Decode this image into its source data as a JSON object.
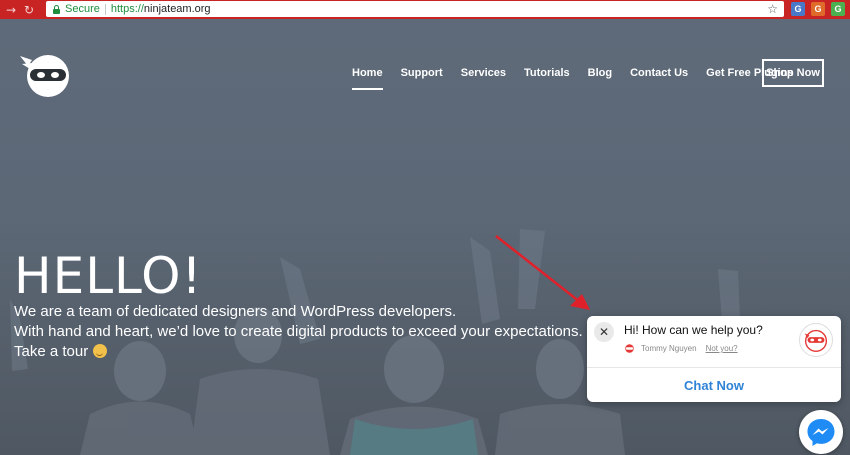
{
  "browser": {
    "back_icon": "back-arrow-icon",
    "reload_icon": "reload-icon",
    "secure_label": "Secure",
    "url_protocol": "https://",
    "url_host": "ninjateam.org",
    "bookmark_icon": "star-icon",
    "extensions": [
      "G",
      "G",
      "G"
    ],
    "chrome_color": "#c92424"
  },
  "header": {
    "logo_icon": "ninja-logo-icon",
    "nav": [
      {
        "label": "Home",
        "active": true
      },
      {
        "label": "Support"
      },
      {
        "label": "Services"
      },
      {
        "label": "Tutorials"
      },
      {
        "label": "Blog"
      },
      {
        "label": "Contact Us"
      },
      {
        "label": "Get Free Plugins"
      }
    ],
    "cta": "Shop Now"
  },
  "hero": {
    "heading": "HELLO!",
    "line1": "We are a team of dedicated designers and WordPress developers.",
    "line2": "With hand and heart, we’d love to create digital products to exceed your expectations.",
    "line3": "Take a tour",
    "emoji_icon": "winking-face-icon"
  },
  "chat": {
    "greeting": "Hi! How can we help you?",
    "agent_name": "Tommy Nguyen",
    "not_you": "Not you?",
    "button": "Chat Now",
    "close_icon": "close-icon",
    "accent": "#2f83d6"
  },
  "messenger": {
    "icon": "messenger-icon",
    "color": "#1f8cf5"
  },
  "annotation": {
    "icon": "red-arrow-icon",
    "color": "#e0202a"
  }
}
